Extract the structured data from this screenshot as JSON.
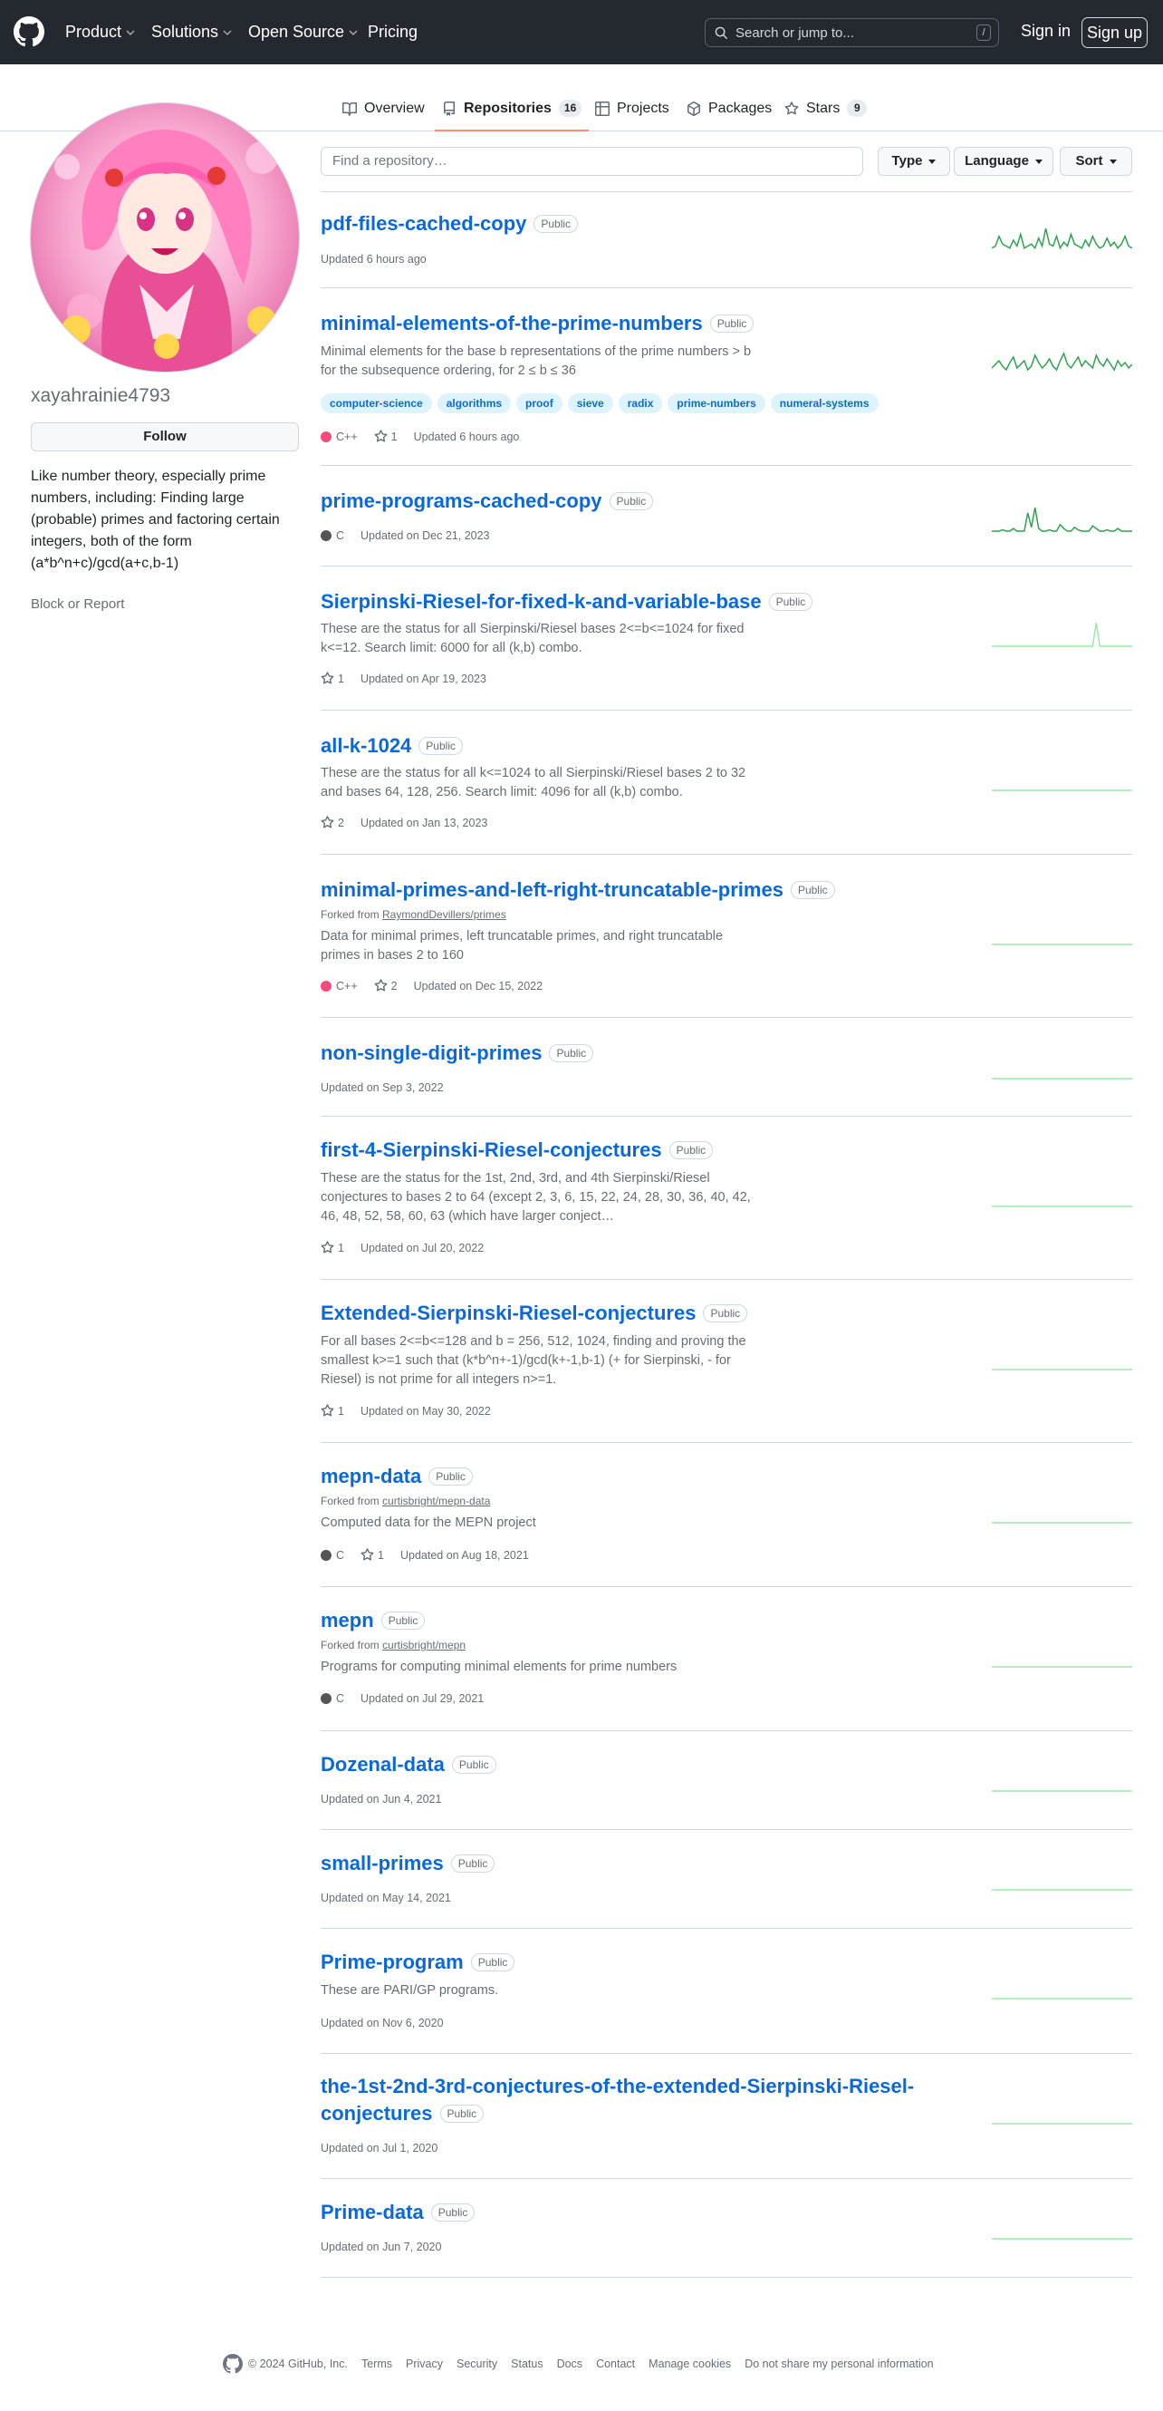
{
  "header": {
    "nav": [
      "Product",
      "Solutions",
      "Open Source",
      "Pricing"
    ],
    "search_placeholder": "Search or jump to...",
    "search_key": "/",
    "sign_in": "Sign in",
    "sign_up": "Sign up"
  },
  "tabs": [
    {
      "label": "Overview",
      "icon": "book-icon",
      "count": ""
    },
    {
      "label": "Repositories",
      "icon": "repo-icon",
      "count": "16"
    },
    {
      "label": "Projects",
      "icon": "table-icon",
      "count": ""
    },
    {
      "label": "Packages",
      "icon": "package-icon",
      "count": ""
    },
    {
      "label": "Stars",
      "icon": "star-icon",
      "count": "9"
    }
  ],
  "profile": {
    "username": "xayahrainie4793",
    "follow": "Follow",
    "bio": "Like number theory, especially prime numbers, including: Finding large (probable) primes and factoring certain integers, both of the form (a*b^n+c)/gcd(a+c,b-1)",
    "block": "Block or Report"
  },
  "filters": {
    "find_placeholder": "Find a repository…",
    "type": "Type",
    "language": "Language",
    "sort": "Sort"
  },
  "colors": {
    "cpp": "#f34b7d",
    "c": "#555555",
    "link": "#0969da",
    "spark_active": "#2da44e",
    "spark_flat": "#9be9a8"
  },
  "repos": [
    {
      "name": "pdf-files-cached-copy",
      "visibility": "Public",
      "fork": "",
      "description": "",
      "topics": [],
      "language": "",
      "stars": "",
      "updated": "Updated 6 hours ago"
    },
    {
      "name": "minimal-elements-of-the-prime-numbers",
      "visibility": "Public",
      "fork": "",
      "description": "Minimal elements for the base b representations of the prime numbers > b for the subsequence ordering, for 2 ≤ b ≤ 36",
      "topics": [
        "computer-science",
        "algorithms",
        "proof",
        "sieve",
        "radix",
        "prime-numbers",
        "numeral-systems"
      ],
      "language": "C++",
      "stars": "1",
      "updated": "Updated 6 hours ago"
    },
    {
      "name": "prime-programs-cached-copy",
      "visibility": "Public",
      "fork": "",
      "description": "",
      "topics": [],
      "language": "C",
      "stars": "",
      "updated": "Updated on Dec 21, 2023"
    },
    {
      "name": "Sierpinski-Riesel-for-fixed-k-and-variable-base",
      "visibility": "Public",
      "fork": "",
      "description": "These are the status for all Sierpinski/Riesel bases 2<=b<=1024 for fixed k<=12. Search limit: 6000 for all (k,b) combo.",
      "topics": [],
      "language": "",
      "stars": "1",
      "updated": "Updated on Apr 19, 2023"
    },
    {
      "name": "all-k-1024",
      "visibility": "Public",
      "fork": "",
      "description": "These are the status for all k<=1024 to all Sierpinski/Riesel bases 2 to 32 and bases 64, 128, 256. Search limit: 4096 for all (k,b) combo.",
      "topics": [],
      "language": "",
      "stars": "2",
      "updated": "Updated on Jan 13, 2023"
    },
    {
      "name": "minimal-primes-and-left-right-truncatable-primes",
      "visibility": "Public",
      "fork": "RaymondDevillers/primes",
      "description": "Data for minimal primes, left truncatable primes, and right truncatable primes in bases 2 to 160",
      "topics": [],
      "language": "C++",
      "stars": "2",
      "updated": "Updated on Dec 15, 2022"
    },
    {
      "name": "non-single-digit-primes",
      "visibility": "Public",
      "fork": "",
      "description": "",
      "topics": [],
      "language": "",
      "stars": "",
      "updated": "Updated on Sep 3, 2022"
    },
    {
      "name": "first-4-Sierpinski-Riesel-conjectures",
      "visibility": "Public",
      "fork": "",
      "description": "These are the status for the 1st, 2nd, 3rd, and 4th Sierpinski/Riesel conjectures to bases 2 to 64 (except 2, 3, 6, 15, 22, 24, 28, 30, 36, 40, 42, 46, 48, 52, 58, 60, 63 (which have larger conject…",
      "topics": [],
      "language": "",
      "stars": "1",
      "updated": "Updated on Jul 20, 2022"
    },
    {
      "name": "Extended-Sierpinski-Riesel-conjectures",
      "visibility": "Public",
      "fork": "",
      "description": "For all bases 2<=b<=128 and b = 256, 512, 1024, finding and proving the smallest k>=1 such that (k*b^n+-1)/gcd(k+-1,b-1) (+ for Sierpinski, - for Riesel) is not prime for all integers n>=1.",
      "topics": [],
      "language": "",
      "stars": "1",
      "updated": "Updated on May 30, 2022"
    },
    {
      "name": "mepn-data",
      "visibility": "Public",
      "fork": "curtisbright/mepn-data",
      "description": "Computed data for the MEPN project",
      "topics": [],
      "language": "C",
      "stars": "1",
      "updated": "Updated on Aug 18, 2021"
    },
    {
      "name": "mepn",
      "visibility": "Public",
      "fork": "curtisbright/mepn",
      "description": "Programs for computing minimal elements for prime numbers",
      "topics": [],
      "language": "C",
      "stars": "",
      "updated": "Updated on Jul 29, 2021"
    },
    {
      "name": "Dozenal-data",
      "visibility": "Public",
      "fork": "",
      "description": "",
      "topics": [],
      "language": "",
      "stars": "",
      "updated": "Updated on Jun 4, 2021"
    },
    {
      "name": "small-primes",
      "visibility": "Public",
      "fork": "",
      "description": "",
      "topics": [],
      "language": "",
      "stars": "",
      "updated": "Updated on May 14, 2021"
    },
    {
      "name": "Prime-program",
      "visibility": "Public",
      "fork": "",
      "description": "These are PARI/GP programs.",
      "topics": [],
      "language": "",
      "stars": "",
      "updated": "Updated on Nov 6, 2020"
    },
    {
      "name": "the-1st-2nd-3rd-conjectures-of-the-extended-Sierpinski-Riesel-conjectures",
      "visibility": "Public",
      "fork": "",
      "description": "",
      "topics": [],
      "language": "",
      "stars": "",
      "updated": "Updated on Jul 1, 2020"
    },
    {
      "name": "Prime-data",
      "visibility": "Public",
      "fork": "",
      "description": "",
      "topics": [],
      "language": "",
      "stars": "",
      "updated": "Updated on Jun 7, 2020"
    }
  ],
  "sparklines": {
    "0": [
      2,
      3,
      8,
      4,
      3,
      2,
      6,
      3,
      9,
      2,
      3,
      4,
      2,
      7,
      3,
      12,
      4,
      3,
      8,
      2,
      5,
      3,
      9,
      4,
      3,
      2,
      6,
      3,
      8,
      4,
      2,
      3,
      7,
      3,
      5,
      2,
      4,
      8,
      3,
      2
    ],
    "1": [
      5,
      7,
      9,
      6,
      4,
      8,
      11,
      5,
      7,
      9,
      4,
      6,
      12,
      8,
      5,
      7,
      10,
      6,
      4,
      9,
      13,
      7,
      5,
      8,
      11,
      6,
      9,
      7,
      5,
      12,
      8,
      6,
      10,
      7,
      4,
      9,
      6,
      8,
      5,
      7
    ],
    "2": [
      0,
      0,
      0,
      1,
      0,
      0,
      2,
      0,
      0,
      0,
      14,
      3,
      18,
      2,
      0,
      0,
      1,
      0,
      0,
      5,
      2,
      0,
      0,
      3,
      1,
      0,
      0,
      0,
      4,
      2,
      0,
      0,
      1,
      0,
      0,
      2,
      0,
      0,
      0,
      0
    ],
    "3": [
      0,
      0,
      0,
      0,
      0,
      0,
      0,
      0,
      0,
      0,
      0,
      0,
      0,
      0,
      0,
      0,
      0,
      0,
      0,
      0,
      0,
      0,
      0,
      0,
      0,
      0,
      0,
      0,
      0,
      1,
      0,
      0,
      0,
      0,
      0,
      0,
      0,
      0,
      0,
      0
    ]
  },
  "footer": {
    "copyright": "© 2024 GitHub, Inc.",
    "links": [
      "Terms",
      "Privacy",
      "Security",
      "Status",
      "Docs",
      "Contact",
      "Manage cookies",
      "Do not share my personal information"
    ]
  }
}
